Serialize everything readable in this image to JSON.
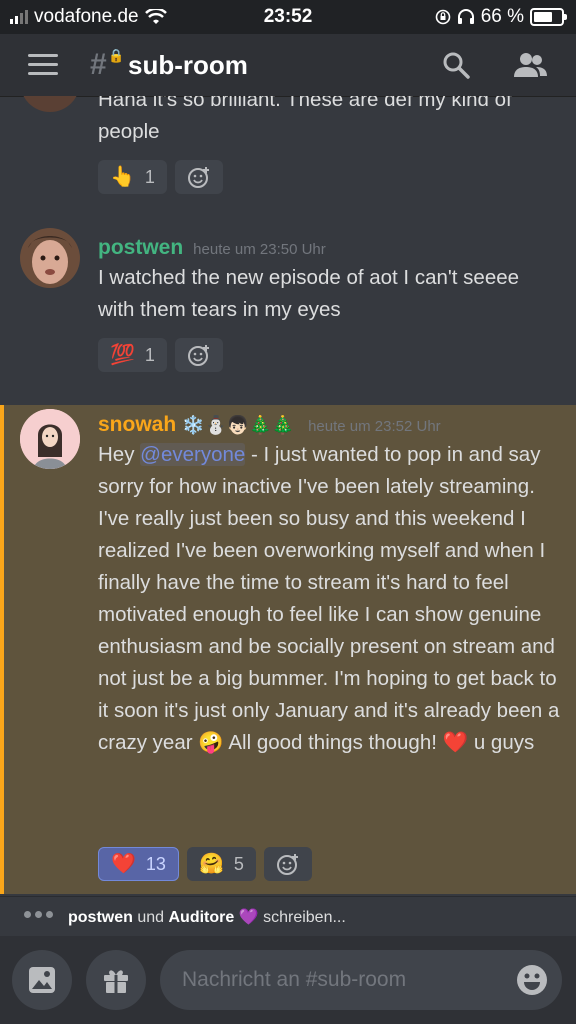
{
  "status_bar": {
    "carrier": "vodafone.de",
    "time": "23:52",
    "battery": "66 %"
  },
  "header": {
    "channel_name": "sub-room",
    "hash_symbol": "#"
  },
  "messages": [
    {
      "text": "Haha it's so brilliant. These are def my kind of people",
      "reactions": [
        {
          "emoji": "👆",
          "count": "1"
        }
      ]
    },
    {
      "username": "postwen",
      "username_color": "#43b581",
      "timestamp": "heute um 23:50 Uhr",
      "text": "I watched the new episode of aot I can't seeee with them tears in my eyes",
      "reactions": [
        {
          "emoji": "💯",
          "count": "1"
        }
      ]
    },
    {
      "username": "snowah",
      "username_color": "#faa61a",
      "username_emojis": "❄️⛄👦🏻🎄🎄",
      "timestamp": "heute um 23:52 Uhr",
      "text_before_mention": "Hey ",
      "mention": "@everyone",
      "text_after_mention": " - I just wanted to pop in and say sorry for how inactive I've been lately streaming. I've really just been so busy and this weekend I realized I've been overworking myself and when I finally have the time to stream it's hard to feel motivated enough to feel like I can show genuine enthusiasm and be socially present on stream and not just be a big bummer. I'm hoping to get back to it soon it's just only January and it's already been a crazy year 🤪 All good things though! ❤️ u guys",
      "reactions": [
        {
          "emoji": "❤️",
          "count": "13",
          "active": true
        },
        {
          "emoji": "🤗",
          "count": "5"
        }
      ]
    }
  ],
  "typing": {
    "user1": "postwen",
    "connector": "und",
    "user2": "Auditore",
    "suffix": "💜 schreiben..."
  },
  "composer": {
    "placeholder": "Nachricht an #sub-room"
  },
  "colors": {
    "background": "#36393f",
    "highlight": "#5f543d",
    "highlight_border": "#faa61a",
    "accent": "#7289da"
  }
}
